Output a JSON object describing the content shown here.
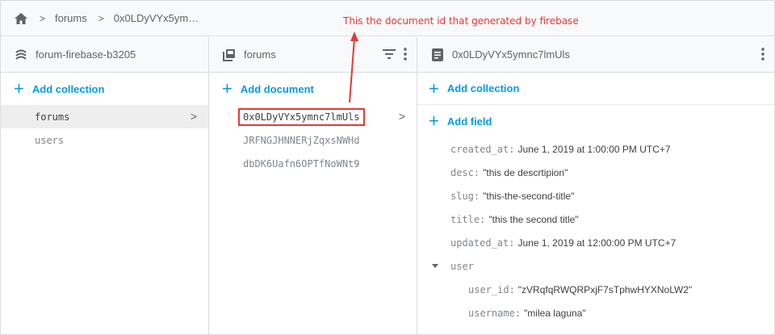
{
  "breadcrumb": {
    "items": [
      "forums",
      "0x0LDyVYx5ym…"
    ]
  },
  "annotation": {
    "text": "This the document id that generated by firebase",
    "color": "#e53935"
  },
  "columns": {
    "root": {
      "title": "forum-firebase-b3205",
      "add_label": "Add collection",
      "collections": [
        {
          "name": "forums",
          "selected": true
        },
        {
          "name": "users",
          "selected": false
        }
      ]
    },
    "collection": {
      "title": "forums",
      "add_label": "Add document",
      "documents": [
        {
          "id": "0x0LDyVYx5ymnc7lmUls",
          "selected": true
        },
        {
          "id": "JRFNGJHNNERjZqxsNWHd",
          "selected": false
        },
        {
          "id": "dbDK6Uafn6OPTfNoWNt9",
          "selected": false
        }
      ]
    },
    "document": {
      "title": "0x0LDyVYx5ymnc7lmUls",
      "add_collection_label": "Add collection",
      "add_field_label": "Add field",
      "fields": [
        {
          "key": "created_at:",
          "value": "June 1, 2019 at 1:00:00 PM UTC+7"
        },
        {
          "key": "desc:",
          "value": "\"this de descrtipion\""
        },
        {
          "key": "slug:",
          "value": "\"this-the-second-title\""
        },
        {
          "key": "title:",
          "value": "\"this the second title\""
        },
        {
          "key": "updated_at:",
          "value": "June 1, 2019 at 12:00:00 PM UTC+7"
        }
      ],
      "map_field": {
        "key": "user",
        "children": [
          {
            "key": "user_id:",
            "value": "\"zVRqfqRWQRPxjF7sTphwHYXNoLW2\""
          },
          {
            "key": "username:",
            "value": "\"milea laguna\""
          }
        ]
      }
    }
  },
  "colors": {
    "accent": "#039be5",
    "highlight_border": "#e53935",
    "selected_row": "#eeeeee"
  },
  "icons": {
    "home": "home-icon",
    "chevron": "chevron-right-icon",
    "database": "database-icon",
    "collection": "collection-icon",
    "document": "document-icon",
    "filter": "filter-icon",
    "more": "more-vert-icon"
  }
}
